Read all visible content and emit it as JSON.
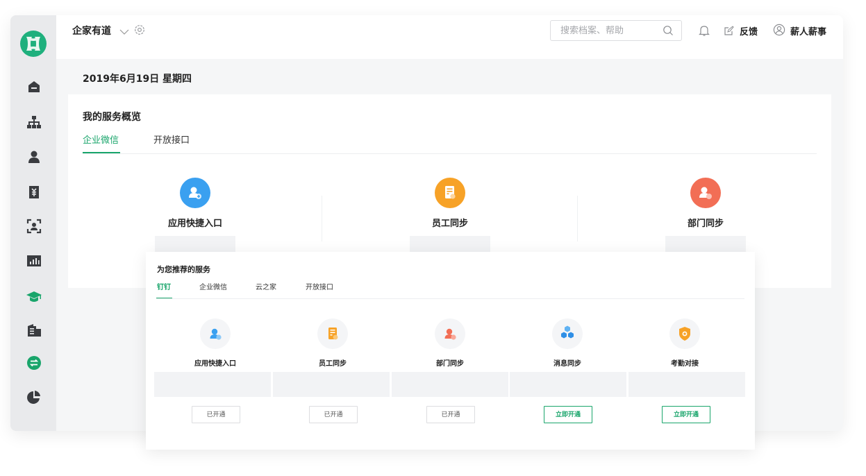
{
  "header": {
    "brand": "企家有道",
    "search_placeholder": "搜索档案、帮助",
    "feedback_label": "反馈",
    "username": "薪人薪事"
  },
  "date_line": "2019年6月19日  星期四",
  "overview": {
    "title": "我的服务概览",
    "tabs": [
      {
        "label": "企业微信",
        "active": true
      },
      {
        "label": "开放接口",
        "active": false
      }
    ],
    "services": [
      {
        "label": "应用快捷入口",
        "icon": "user-plus-icon",
        "color": "#3aa0f0"
      },
      {
        "label": "员工同步",
        "icon": "document-icon",
        "color": "#f7a227"
      },
      {
        "label": "部门同步",
        "icon": "user-edit-icon",
        "color": "#f26e55"
      }
    ]
  },
  "recommend": {
    "title": "为您推荐的服务",
    "tabs": [
      {
        "label": "钉钉",
        "active": true
      },
      {
        "label": "企业微信",
        "active": false
      },
      {
        "label": "云之家",
        "active": false
      },
      {
        "label": "开放接口",
        "active": false
      }
    ],
    "cards": [
      {
        "label": "应用快捷入口",
        "icon": "user-plus-icon",
        "button": "已开通",
        "button_style": "outline-gray"
      },
      {
        "label": "员工同步",
        "icon": "document-icon",
        "button": "已开通",
        "button_style": "outline-gray"
      },
      {
        "label": "部门同步",
        "icon": "user-edit-icon",
        "button": "已开通",
        "button_style": "outline-gray"
      },
      {
        "label": "消息同步",
        "icon": "hexagon-cluster-icon",
        "button": "立即开通",
        "button_style": "outline-green"
      },
      {
        "label": "考勤对接",
        "icon": "shield-icon",
        "button": "立即开通",
        "button_style": "outline-green"
      }
    ]
  },
  "colors": {
    "accent": "#19a56b",
    "sidebar_icon": "#3a3c40",
    "sidebar_active": "#19a56b"
  }
}
